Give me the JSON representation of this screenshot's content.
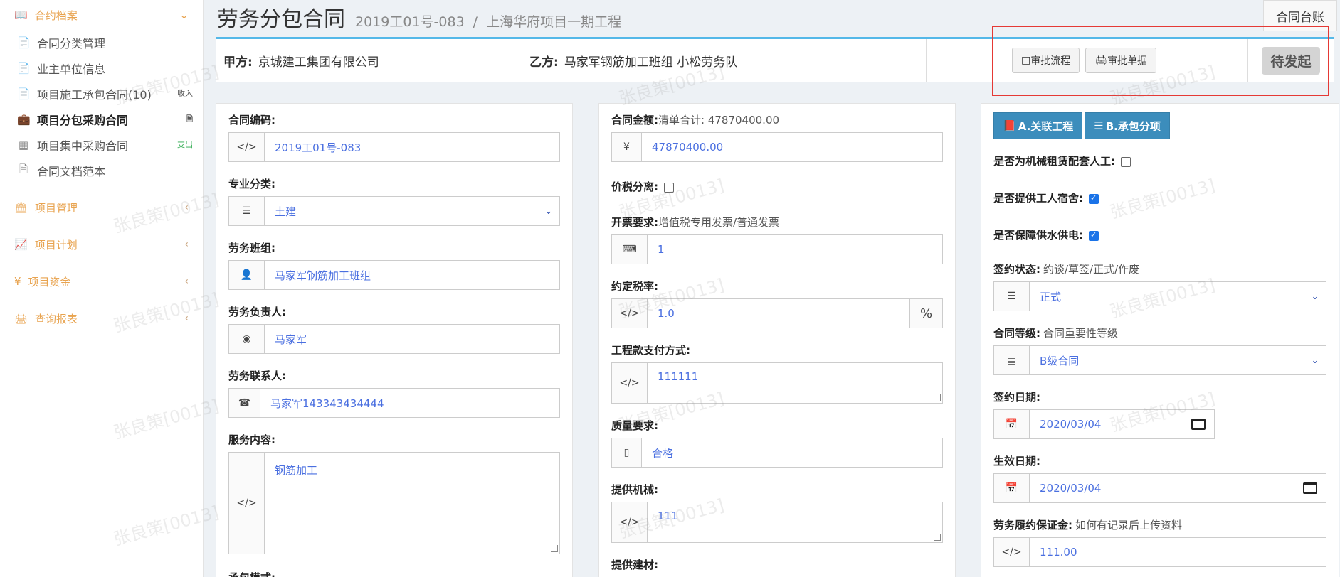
{
  "sidebar": {
    "header": "合约档案",
    "sub_items": [
      {
        "label": "合同分类管理",
        "tag": ""
      },
      {
        "label": "业主单位信息",
        "tag": ""
      },
      {
        "label": "项目施工承包合同(10)",
        "tag": "收入"
      },
      {
        "label": "项目分包采购合同",
        "tag": ""
      },
      {
        "label": "项目集中采购合同",
        "tag": "支出"
      },
      {
        "label": "合同文档范本",
        "tag": ""
      }
    ],
    "groups": [
      {
        "label": "项目管理"
      },
      {
        "label": "项目计划"
      },
      {
        "label": "项目资金"
      },
      {
        "label": "查询报表"
      }
    ]
  },
  "header": {
    "title": "劳务分包合同",
    "code": "2019工01号-083",
    "sep": "/",
    "project": "上海华府项目一期工程",
    "ledger_button": "合同台账"
  },
  "parties": {
    "party_a_label": "甲方:",
    "party_a": "京城建工集团有限公司",
    "party_b_label": "乙方:",
    "party_b": "马家军钢筋加工班组 小松劳务队",
    "approval_flow_button": "审批流程",
    "approval_doc_button": "审批单据",
    "status": "待发起"
  },
  "col1": {
    "contract_code_label": "合同编码:",
    "contract_code": "2019工01号-083",
    "category_label": "专业分类:",
    "category": "土建",
    "team_label": "劳务班组:",
    "team": "马家军钢筋加工班组",
    "leader_label": "劳务负责人:",
    "leader": "马家军",
    "contact_label": "劳务联系人:",
    "contact": "马家军143343434444",
    "service_label": "服务内容:",
    "service": "钢筋加工",
    "mode_label": "承包模式:"
  },
  "col2": {
    "amount_label": "合同金额:",
    "amount_hint": "清单合计: 47870400.00",
    "amount_symbol": "¥",
    "amount": "47870400.00",
    "tax_sep_label": "价税分离:",
    "invoice_label": "开票要求:",
    "invoice_hint": "增值税专用发票/普通发票",
    "invoice": "1",
    "tax_rate_label": "约定税率:",
    "tax_rate": "1.0",
    "percent": "%",
    "payment_label": "工程款支付方式:",
    "payment": "111111",
    "quality_label": "质量要求:",
    "quality": "合格",
    "machinery_label": "提供机械:",
    "machinery": "111",
    "material_label": "提供建材:"
  },
  "col3": {
    "btn_a": "A.关联工程",
    "btn_b": "B.承包分项",
    "q_machine_label": "是否为机械租赁配套人工:",
    "q_machine": false,
    "q_dorm_label": "是否提供工人宿舍:",
    "q_dorm": true,
    "q_water_label": "是否保障供水供电:",
    "q_water": true,
    "sign_status_label": "签约状态:",
    "sign_status_hint": "约谈/草签/正式/作废",
    "sign_status": "正式",
    "grade_label": "合同等级:",
    "grade_hint": "合同重要性等级",
    "grade": "B级合同",
    "sign_date_label": "签约日期:",
    "sign_date": "2020/03/04",
    "effective_date_label": "生效日期:",
    "effective_date": "2020/03/04",
    "deposit_label": "劳务履约保证金:",
    "deposit_hint": "如何有记录后上传资料",
    "deposit": "111.00"
  },
  "watermark": "张良策[0013]",
  "colors": {
    "accent": "#e8a34f",
    "blue_btn": "#3c8dbc",
    "value_text": "#4a6fe0",
    "highlight": "#e53935"
  }
}
